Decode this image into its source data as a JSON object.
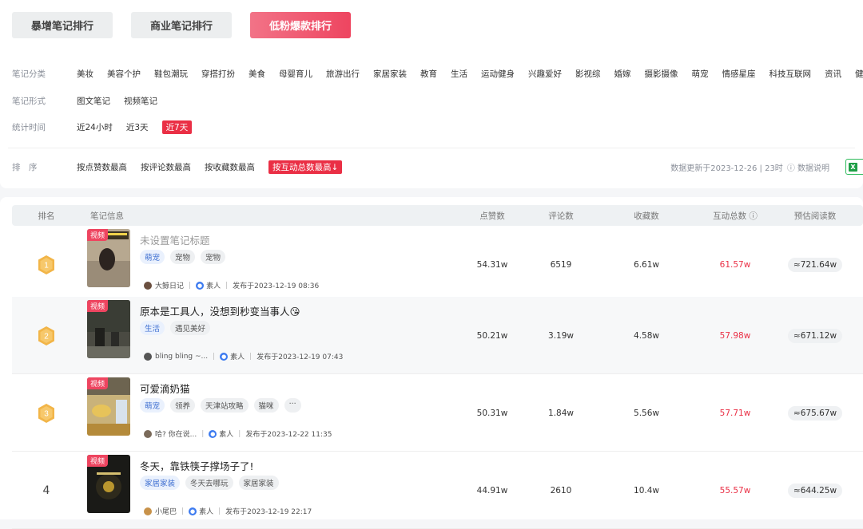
{
  "tabs": [
    "暴增笔记排行",
    "商业笔记排行",
    "低粉爆款排行"
  ],
  "filters": {
    "category_label": "笔记分类",
    "categories": [
      "美妆",
      "美容个护",
      "鞋包潮玩",
      "穿搭打扮",
      "美食",
      "母婴育儿",
      "旅游出行",
      "家居家装",
      "教育",
      "生活",
      "运动健身",
      "兴趣爱好",
      "影视综",
      "婚嫁",
      "摄影摄像",
      "萌宠",
      "情感星座",
      "科技互联网",
      "资讯",
      "健康"
    ],
    "form_label": "笔记形式",
    "forms": [
      "图文笔记",
      "视频笔记"
    ],
    "time_label": "统计时间",
    "times": [
      "近24小时",
      "近3天",
      "近7天"
    ],
    "sort_label": "排　序",
    "sorts": [
      "按点赞数最高",
      "按评论数最高",
      "按收藏数最高",
      "按互动总数最高↓"
    ],
    "update_text": "数据更新于2023-12-26 | 23时",
    "info_text": "ⓘ 数据说明",
    "excel_icon": "X"
  },
  "table": {
    "headers": [
      "排名",
      "笔记信息",
      "点赞数",
      "评论数",
      "收藏数",
      "互动总数 ⓘ",
      "预估阅读数"
    ],
    "rows": [
      {
        "rank": "1",
        "title": "未设置笔记标题",
        "badge": "视频",
        "tags": [
          "萌宠",
          "宠物",
          "宠物"
        ],
        "author": "大鲸日记",
        "role": "素人",
        "date": "发布于2023-12-19 08:36",
        "likes": "54.31w",
        "comments": "6519",
        "favorites": "6.61w",
        "total": "61.57w",
        "reads": "≈721.64w"
      },
      {
        "rank": "2",
        "title": "原本是工具人，没想到秒变当事人😘",
        "badge": "视频",
        "tags": [
          "生活",
          "遇见美好"
        ],
        "author": "bling bling ~...",
        "role": "素人",
        "date": "发布于2023-12-19 07:43",
        "likes": "50.21w",
        "comments": "3.19w",
        "favorites": "4.58w",
        "total": "57.98w",
        "reads": "≈671.12w"
      },
      {
        "rank": "3",
        "title": "可爱滴奶猫",
        "badge": "视频",
        "tags": [
          "萌宠",
          "领养",
          "天津站攻略",
          "猫咪",
          "···"
        ],
        "author": "哈? 你在说...",
        "role": "素人",
        "date": "发布于2023-12-22 11:35",
        "likes": "50.31w",
        "comments": "1.84w",
        "favorites": "5.56w",
        "total": "57.71w",
        "reads": "≈675.67w"
      },
      {
        "rank": "4",
        "title": "冬天，靠铁筷子撑场子了!",
        "badge": "视频",
        "tags": [
          "家居家装",
          "冬天去哪玩",
          "家居家装"
        ],
        "author": "小尾巴",
        "role": "素人",
        "date": "发布于2023-12-19 22:17",
        "likes": "44.91w",
        "comments": "2610",
        "favorites": "10.4w",
        "total": "55.57w",
        "reads": "≈644.25w"
      }
    ]
  },
  "colors": {
    "accent": "#ea2f45",
    "tag_blue": "#3e6fd1",
    "medal_gold": "#f2b548"
  }
}
